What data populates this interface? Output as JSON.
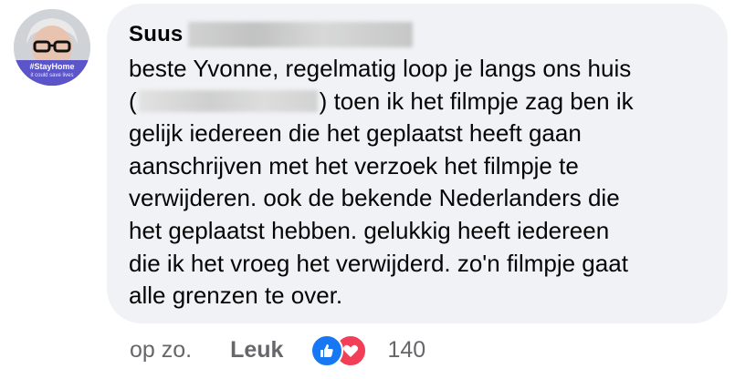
{
  "comment": {
    "author": "Suus",
    "avatar_badge": "#StayHome",
    "avatar_subtext": "it could save lives",
    "body_lines": [
      "beste Yvonne, regelmatig loop je langs ons huis",
      "toen ik het filmpje zag ben ik",
      "gelijk iedereen die het geplaatst heeft gaan",
      "aanschrijven met het verzoek het filmpje te",
      "verwijderen. ook de bekende Nederlanders die",
      "het geplaatst  hebben. gelukkig heeft iedereen",
      "die ik het vroeg het verwijderd. zo'n filmpje gaat",
      "alle grenzen te over."
    ]
  },
  "actions": {
    "time": "op zo.",
    "like_label": "Leuk",
    "reaction_count": "140",
    "reaction_icons": [
      "like-icon",
      "love-icon"
    ]
  },
  "colors": {
    "bubble_bg": "#f0f2f5",
    "meta_text": "#65676b",
    "like_blue": "#1877f2",
    "love_red": "#f33e58"
  }
}
